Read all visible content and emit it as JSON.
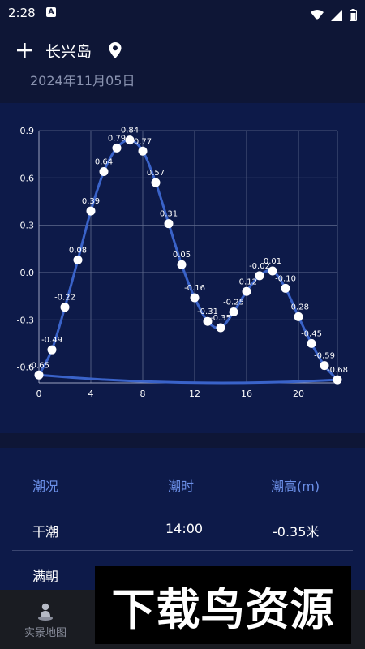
{
  "status_bar": {
    "time": "2:28",
    "notification_badge": "A"
  },
  "header": {
    "location": "长兴岛",
    "date": "2024年11月05日",
    "add_icon": "plus-icon",
    "location_icon": "map-pin-icon"
  },
  "chart_data": {
    "type": "line",
    "x": [
      0,
      1,
      2,
      3,
      4,
      5,
      6,
      7,
      8,
      9,
      10,
      11,
      12,
      13,
      14,
      15,
      16,
      17,
      18,
      19,
      20,
      21,
      22,
      23
    ],
    "values": [
      -0.65,
      -0.49,
      -0.22,
      0.08,
      0.39,
      0.64,
      0.79,
      0.84,
      0.77,
      0.57,
      0.31,
      0.05,
      -0.16,
      -0.31,
      -0.35,
      -0.25,
      -0.12,
      -0.02,
      0.01,
      -0.1,
      -0.28,
      -0.45,
      -0.59,
      -0.68
    ],
    "labels": [
      "-0.65",
      "-0.49",
      "-0.22",
      "0.08",
      "0.39",
      "0.64",
      "0.79",
      "0.84",
      "0.77",
      "0.57",
      "0.31",
      "0.05",
      "-0.16",
      "-0.31",
      "-0.35",
      "-0.25",
      "-0.12",
      "-0.02",
      "0.01",
      "-0.10",
      "-0.28",
      "-0.45",
      "-0.59",
      "-0.68"
    ],
    "x_ticks": [
      "0",
      "4",
      "8",
      "12",
      "16",
      "20"
    ],
    "x_tick_values": [
      0,
      4,
      8,
      12,
      16,
      20
    ],
    "y_ticks": [
      "0.9",
      "0.6",
      "0.3",
      "0.0",
      "-0.3",
      "-0.6"
    ],
    "y_tick_values": [
      0.9,
      0.6,
      0.3,
      0.0,
      -0.3,
      -0.6
    ],
    "xlim": [
      0,
      23
    ],
    "ylim": [
      -0.7,
      0.9
    ],
    "line_color": "#3a63c9",
    "grid": true
  },
  "table": {
    "headers": [
      "潮况",
      "潮时",
      "潮高(m)"
    ],
    "rows": [
      {
        "type": "干潮",
        "time": "14:00",
        "height": "-0.35米"
      },
      {
        "type": "满朝",
        "time": "",
        "height": ""
      }
    ]
  },
  "bottom_nav": {
    "label": "实景地图",
    "icon": "person-location-icon"
  },
  "watermark": {
    "text": "下载鸟资源"
  },
  "colors": {
    "background": "#0e1636",
    "panel": "#0d1a49",
    "accent": "#6c90e8"
  }
}
